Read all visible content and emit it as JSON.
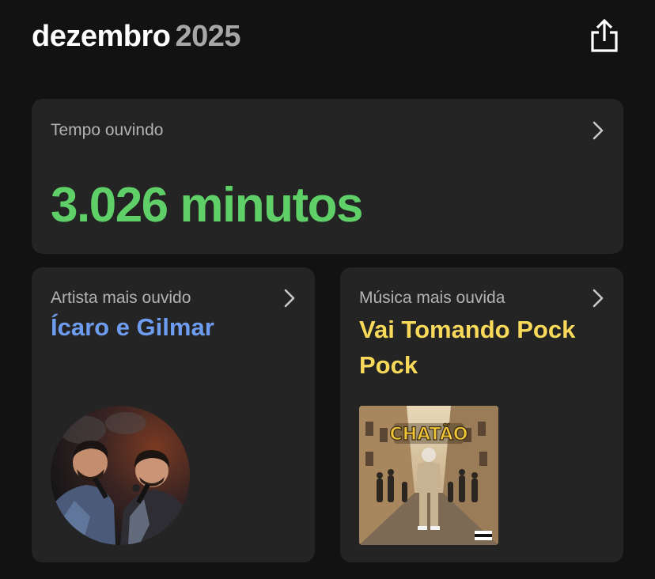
{
  "header": {
    "month": "dezembro",
    "year": "2025",
    "share_icon": "share-icon"
  },
  "listening_time": {
    "label": "Tempo ouvindo",
    "value": "3.026 minutos"
  },
  "top_artist": {
    "label": "Artista mais ouvido",
    "name": "Ícaro e Gilmar"
  },
  "top_song": {
    "label": "Música mais ouvida",
    "name": "Vai Tomando Pock Pock",
    "album_cover_text": "CHATÃO"
  },
  "colors": {
    "background": "#121212",
    "card": "#242424",
    "minutes_green": "#5fd068",
    "artist_blue": "#6d9cf0",
    "song_yellow": "#f8d95a",
    "label_gray": "#b3b3b3",
    "year_gray": "#a7a7a7"
  }
}
